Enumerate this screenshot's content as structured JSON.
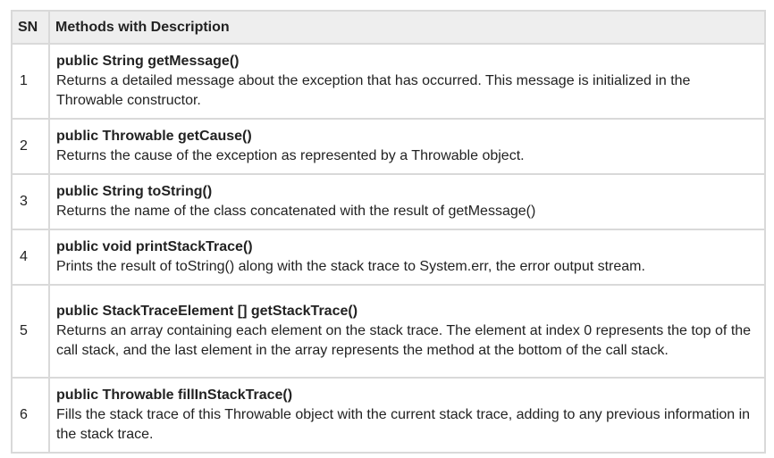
{
  "table": {
    "headers": {
      "sn": "SN",
      "description": "Methods with Description"
    },
    "rows": [
      {
        "sn": "1",
        "signature": "public String getMessage()",
        "description": "Returns a detailed message about the exception that has occurred. This message is initialized in the Throwable constructor."
      },
      {
        "sn": "2",
        "signature": "public Throwable getCause()",
        "description": "Returns the cause of the exception as represented by a Throwable object."
      },
      {
        "sn": "3",
        "signature": "public String toString()",
        "description": "Returns the name of the class concatenated with the result of getMessage()"
      },
      {
        "sn": "4",
        "signature": "public void printStackTrace()",
        "description": "Prints the result of toString() along with the stack trace to System.err, the error output stream."
      },
      {
        "sn": "5",
        "signature": "public StackTraceElement [] getStackTrace()",
        "description": "Returns an array containing each element on the stack trace. The element at index 0 represents the top of the call stack, and the last element in the array represents the method at the bottom of the call stack."
      },
      {
        "sn": "6",
        "signature": "public Throwable fillInStackTrace()",
        "description": "Fills the stack trace of this Throwable object with the current stack trace, adding to any previous information in the stack trace."
      }
    ]
  }
}
